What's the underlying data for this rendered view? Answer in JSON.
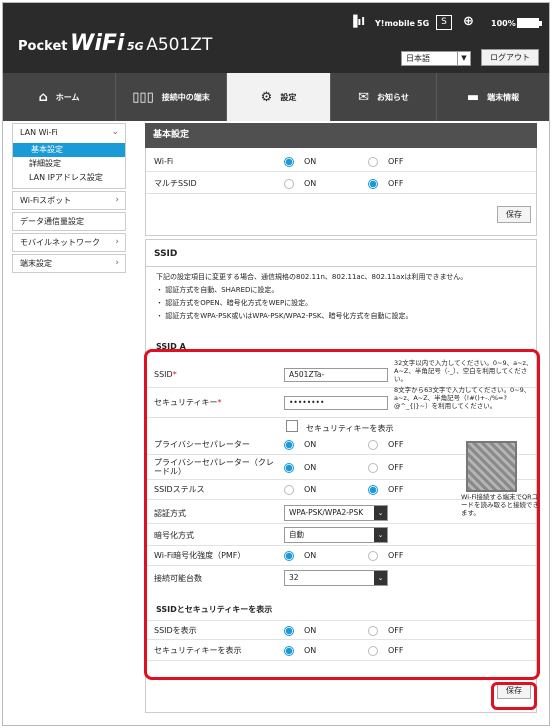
{
  "header": {
    "brand_pocket": "Pocket",
    "brand_wifi": "WiFi",
    "brand_5g": "5G",
    "brand_model": "A501ZT",
    "signal_label": "Y!mobile",
    "net_label": "5G",
    "sim_label": "S",
    "battery": "100%",
    "lang": "日本語",
    "logout": "ログアウト"
  },
  "icons": {
    "signal": "signal-bars-icon",
    "wifi": "wifi-icon",
    "globe": "globe-icon",
    "battery": "battery-icon",
    "home": "home-icon",
    "devices": "devices-icon",
    "gear": "gear-icon",
    "mail": "mail-icon",
    "device": "device-info-icon"
  },
  "nav": {
    "home": "ホーム",
    "devices": "接続中の端末",
    "settings": "設定",
    "news": "お知らせ",
    "info": "端末情報"
  },
  "sidebar": {
    "lan": "LAN Wi-Fi",
    "basic": "基本設定",
    "detail": "詳細設定",
    "lanip": "LAN IPアドレス設定",
    "spot": "Wi-Fiスポット",
    "data": "データ通信量設定",
    "mobile": "モバイルネットワーク",
    "device": "端末設定"
  },
  "basic": {
    "title": "基本設定",
    "wifi": "Wi-Fi",
    "multi": "マルチSSID",
    "on": "ON",
    "off": "OFF",
    "save": "保存"
  },
  "ssid": {
    "title": "SSID",
    "intro": "下記の設定項目に変更する場合、通信規格の802.11n、802.11ac、802.11axは利用できません。",
    "b1": "・ 認証方式を自動、SHAREDに設定。",
    "b2": "・ 認証方式をOPEN、暗号化方式をWEPに設定。",
    "b3": "・ 認証方式をWPA-PSK或いはWPA-PSK/WPA2-PSK、暗号化方式を自動に設定。",
    "ssida": "SSID A",
    "ssid_label": "SSID",
    "ssid_req": "*",
    "ssid_value": "A501ZTa-",
    "ssid_note": "32文字以内で入力してください。0~9、a~z、A~Z、半角記号（-_）、空白を利用してください。",
    "key_label": "セキュリティキー",
    "key_req": "*",
    "key_value": "••••••••",
    "key_note": "8文字から63文字で入力してください。0~9、a~z、A~Z、半角記号（!#()+-./%=?@^_{|}~）を利用してください。",
    "show_key": "セキュリティキーを表示",
    "privacy": "プライバシーセパレーター",
    "privacy_cradle": "プライバシーセパレーター（クレードル）",
    "stealth": "SSIDステルス",
    "auth": "認証方式",
    "auth_value": "WPA-PSK/WPA2-PSK",
    "enc": "暗号化方式",
    "enc_value": "自動",
    "pmf": "Wi-Fi暗号化強度（PMF）",
    "max": "接続可能台数",
    "max_value": "32",
    "qr_note": "Wi-Fi接続する端末でQRコードを読み取ると接続できます。",
    "display_head": "SSIDとセキュリティキーを表示",
    "show_ssid": "SSIDを表示",
    "show_key2": "セキュリティキーを表示",
    "on": "ON",
    "off": "OFF",
    "save": "保存"
  }
}
